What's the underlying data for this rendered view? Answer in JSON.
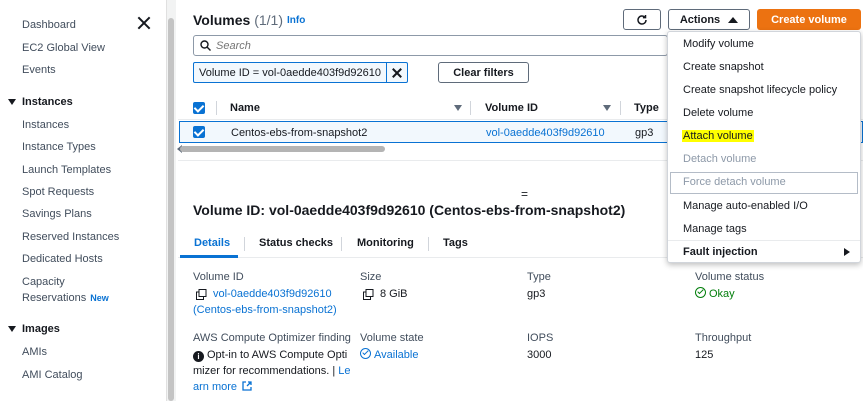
{
  "sidebar": {
    "items": [
      {
        "label": "Dashboard"
      },
      {
        "label": "EC2 Global View"
      },
      {
        "label": "Events"
      }
    ],
    "instances_section": "Instances",
    "instances_items": [
      {
        "label": "Instances"
      },
      {
        "label": "Instance Types"
      },
      {
        "label": "Launch Templates"
      },
      {
        "label": "Spot Requests"
      },
      {
        "label": "Savings Plans"
      },
      {
        "label": "Reserved Instances"
      },
      {
        "label": "Dedicated Hosts"
      },
      {
        "label": "Capacity"
      }
    ],
    "capacity_line2": "Reservations",
    "new_badge": "New",
    "images_section": "Images",
    "images_items": [
      {
        "label": "AMIs"
      },
      {
        "label": "AMI Catalog"
      }
    ]
  },
  "header": {
    "title": "Volumes",
    "count": "(1/1)",
    "info": "Info",
    "actions_label": "Actions",
    "create_label": "Create volume"
  },
  "search": {
    "placeholder": "Search",
    "filter_token": "Volume ID = vol-0aedde403f9d92610",
    "clear_label": "Clear filters"
  },
  "table": {
    "columns": [
      "Name",
      "Volume ID",
      "Type"
    ],
    "rows": [
      {
        "name": "Centos-ebs-from-snapshot2",
        "volume_id": "vol-0aedde403f9d92610",
        "type": "gp3"
      }
    ]
  },
  "split_handle": "=",
  "detail": {
    "title": "Volume ID: vol-0aedde403f9d92610 (Centos-ebs-from-snapshot2)",
    "tabs": [
      "Details",
      "Status checks",
      "Monitoring",
      "Tags"
    ],
    "fields": {
      "volume_id_label": "Volume ID",
      "volume_id_value": "vol-0aedde403f9d92610",
      "volume_id_name": "(Centos-ebs-from-snapshot2)",
      "size_label": "Size",
      "size_value": "8 GiB",
      "type_label": "Type",
      "type_value": "gp3",
      "status_label": "Volume status",
      "status_value": "Okay",
      "optimizer_label": "AWS Compute Optimizer finding",
      "optimizer_line1": "Opt-in to AWS Compute Opti",
      "optimizer_line2": "mizer for recommendations. | ",
      "optimizer_link1": "Le",
      "optimizer_link2": "arn more",
      "state_label": "Volume state",
      "state_value": "Available",
      "iops_label": "IOPS",
      "iops_value": "3000",
      "throughput_label": "Throughput",
      "throughput_value": "125"
    }
  },
  "actions_menu": {
    "items": [
      {
        "label": "Modify volume"
      },
      {
        "label": "Create snapshot"
      },
      {
        "label": "Create snapshot lifecycle policy"
      },
      {
        "label": "Delete volume"
      },
      {
        "label": "Attach volume"
      },
      {
        "label": "Detach volume"
      },
      {
        "label": "Force detach volume"
      },
      {
        "label": "Manage auto-enabled I/O"
      },
      {
        "label": "Manage tags"
      },
      {
        "label": "Fault injection"
      }
    ]
  },
  "colors": {
    "accent": "#0972d3",
    "primary_button": "#ec7211",
    "highlight": "#ffff00",
    "ok": "#037f0c"
  }
}
